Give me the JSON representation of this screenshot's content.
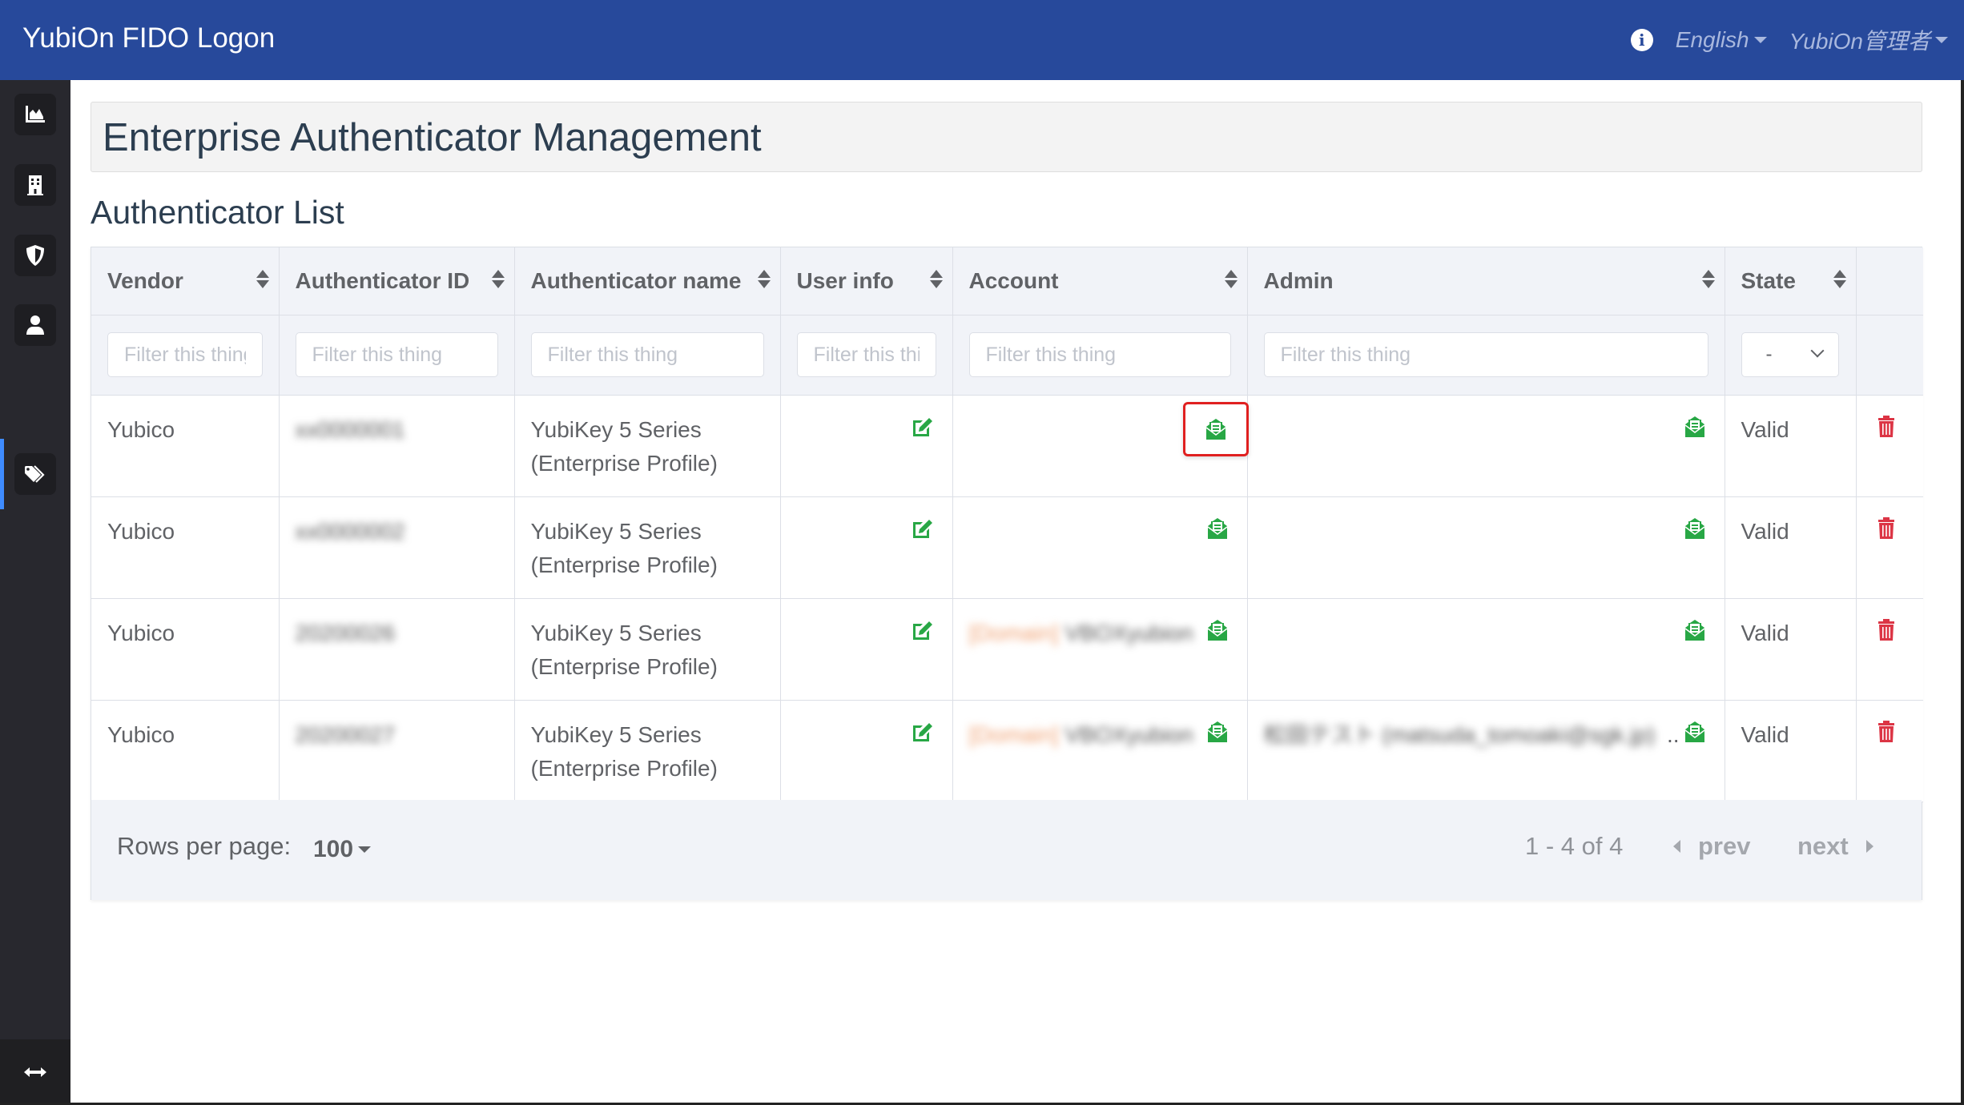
{
  "app": {
    "title": "YubiOn FIDO Logon",
    "nav": {
      "info_icon": "info-circle-icon",
      "language": "English",
      "user": "YubiOn管理者"
    }
  },
  "sidebar": {
    "items": [
      {
        "name": "dashboard",
        "icon": "area-chart-icon",
        "active": false
      },
      {
        "name": "organization",
        "icon": "building-icon",
        "active": false
      },
      {
        "name": "security",
        "icon": "shield-icon",
        "active": false
      },
      {
        "name": "users",
        "icon": "user-icon",
        "active": false
      },
      {
        "name": "authenticators",
        "icon": "tags-icon",
        "active": true
      }
    ],
    "footer_icon": "arrows-horizontal-icon"
  },
  "page": {
    "title": "Enterprise Authenticator Management",
    "section_title": "Authenticator List"
  },
  "table": {
    "columns": [
      {
        "key": "vendor",
        "label": "Vendor",
        "sortable": true,
        "filter_placeholder": "Filter this thing"
      },
      {
        "key": "auth_id",
        "label": "Authenticator ID",
        "sortable": true,
        "filter_placeholder": "Filter this thing"
      },
      {
        "key": "auth_name",
        "label": "Authenticator name",
        "sortable": true,
        "filter_placeholder": "Filter this thing"
      },
      {
        "key": "user_info",
        "label": "User info",
        "sortable": true,
        "filter_placeholder": "Filter this thing"
      },
      {
        "key": "account",
        "label": "Account",
        "sortable": true,
        "filter_placeholder": "Filter this thing"
      },
      {
        "key": "admin",
        "label": "Admin",
        "sortable": true,
        "filter_placeholder": "Filter this thing"
      },
      {
        "key": "state",
        "label": "State",
        "sortable": true,
        "filter_value": "-"
      },
      {
        "key": "actions",
        "label": ""
      }
    ],
    "rows": [
      {
        "vendor": "Yubico",
        "auth_id": "xx0000001",
        "auth_name_line1": "YubiKey 5 Series",
        "auth_name_line2": "(Enterprise Profile)",
        "account_prefix": "",
        "account": "",
        "admin": "",
        "state": "Valid"
      },
      {
        "vendor": "Yubico",
        "auth_id": "xx0000002",
        "auth_name_line1": "YubiKey 5 Series",
        "auth_name_line2": "(Enterprise Profile)",
        "account_prefix": "",
        "account": "",
        "admin": "",
        "state": "Valid"
      },
      {
        "vendor": "Yubico",
        "auth_id": "20200026",
        "auth_name_line1": "YubiKey 5 Series",
        "auth_name_line2": "(Enterprise Profile)",
        "account_prefix": "[Domain]",
        "account": "VBOXyubion",
        "admin": "",
        "state": "Valid"
      },
      {
        "vendor": "Yubico",
        "auth_id": "20200027",
        "auth_name_line1": "YubiKey 5 Series",
        "auth_name_line2": "(Enterprise Profile)",
        "account_prefix": "[Domain]",
        "account": "VBOXyubion",
        "admin": "松田テスト (matsuda_tomoaki@sgk.jp)",
        "admin_ellipsis": "..",
        "state": "Valid"
      }
    ]
  },
  "footer": {
    "rows_per_page_label": "Rows per page:",
    "rows_per_page_value": "100",
    "range": "1 - 4 of 4",
    "prev": "prev",
    "next": "next"
  },
  "colors": {
    "topbar": "#27499b",
    "sidebar": "#28282e",
    "active_indicator": "#3f8cff",
    "action_green": "#28a745",
    "delete_red": "#dc3545",
    "highlight_red": "#e02020"
  }
}
